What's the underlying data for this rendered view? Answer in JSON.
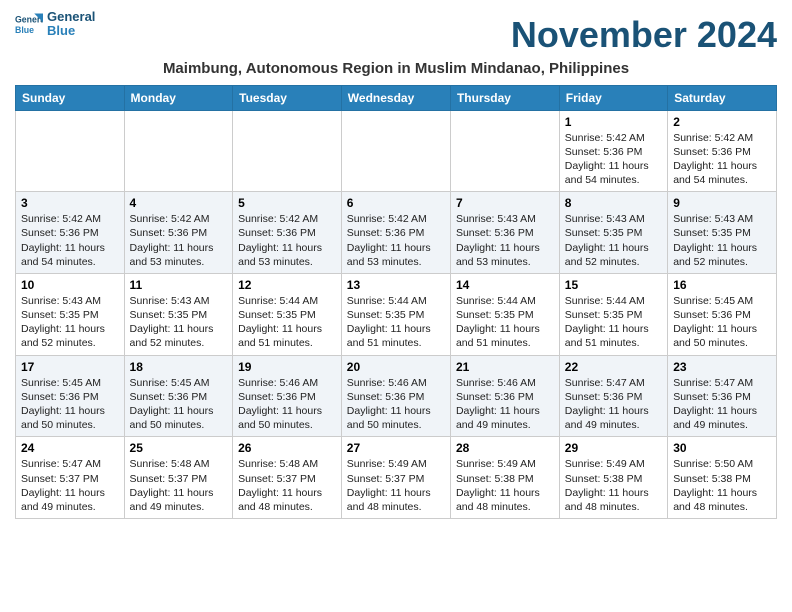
{
  "logo": {
    "line1": "General",
    "line2": "Blue"
  },
  "month_title": "November 2024",
  "location": "Maimbung, Autonomous Region in Muslim Mindanao, Philippines",
  "days_of_week": [
    "Sunday",
    "Monday",
    "Tuesday",
    "Wednesday",
    "Thursday",
    "Friday",
    "Saturday"
  ],
  "weeks": [
    [
      {
        "day": "",
        "info": ""
      },
      {
        "day": "",
        "info": ""
      },
      {
        "day": "",
        "info": ""
      },
      {
        "day": "",
        "info": ""
      },
      {
        "day": "",
        "info": ""
      },
      {
        "day": "1",
        "info": "Sunrise: 5:42 AM\nSunset: 5:36 PM\nDaylight: 11 hours and 54 minutes."
      },
      {
        "day": "2",
        "info": "Sunrise: 5:42 AM\nSunset: 5:36 PM\nDaylight: 11 hours and 54 minutes."
      }
    ],
    [
      {
        "day": "3",
        "info": "Sunrise: 5:42 AM\nSunset: 5:36 PM\nDaylight: 11 hours and 54 minutes."
      },
      {
        "day": "4",
        "info": "Sunrise: 5:42 AM\nSunset: 5:36 PM\nDaylight: 11 hours and 53 minutes."
      },
      {
        "day": "5",
        "info": "Sunrise: 5:42 AM\nSunset: 5:36 PM\nDaylight: 11 hours and 53 minutes."
      },
      {
        "day": "6",
        "info": "Sunrise: 5:42 AM\nSunset: 5:36 PM\nDaylight: 11 hours and 53 minutes."
      },
      {
        "day": "7",
        "info": "Sunrise: 5:43 AM\nSunset: 5:36 PM\nDaylight: 11 hours and 53 minutes."
      },
      {
        "day": "8",
        "info": "Sunrise: 5:43 AM\nSunset: 5:35 PM\nDaylight: 11 hours and 52 minutes."
      },
      {
        "day": "9",
        "info": "Sunrise: 5:43 AM\nSunset: 5:35 PM\nDaylight: 11 hours and 52 minutes."
      }
    ],
    [
      {
        "day": "10",
        "info": "Sunrise: 5:43 AM\nSunset: 5:35 PM\nDaylight: 11 hours and 52 minutes."
      },
      {
        "day": "11",
        "info": "Sunrise: 5:43 AM\nSunset: 5:35 PM\nDaylight: 11 hours and 52 minutes."
      },
      {
        "day": "12",
        "info": "Sunrise: 5:44 AM\nSunset: 5:35 PM\nDaylight: 11 hours and 51 minutes."
      },
      {
        "day": "13",
        "info": "Sunrise: 5:44 AM\nSunset: 5:35 PM\nDaylight: 11 hours and 51 minutes."
      },
      {
        "day": "14",
        "info": "Sunrise: 5:44 AM\nSunset: 5:35 PM\nDaylight: 11 hours and 51 minutes."
      },
      {
        "day": "15",
        "info": "Sunrise: 5:44 AM\nSunset: 5:35 PM\nDaylight: 11 hours and 51 minutes."
      },
      {
        "day": "16",
        "info": "Sunrise: 5:45 AM\nSunset: 5:36 PM\nDaylight: 11 hours and 50 minutes."
      }
    ],
    [
      {
        "day": "17",
        "info": "Sunrise: 5:45 AM\nSunset: 5:36 PM\nDaylight: 11 hours and 50 minutes."
      },
      {
        "day": "18",
        "info": "Sunrise: 5:45 AM\nSunset: 5:36 PM\nDaylight: 11 hours and 50 minutes."
      },
      {
        "day": "19",
        "info": "Sunrise: 5:46 AM\nSunset: 5:36 PM\nDaylight: 11 hours and 50 minutes."
      },
      {
        "day": "20",
        "info": "Sunrise: 5:46 AM\nSunset: 5:36 PM\nDaylight: 11 hours and 50 minutes."
      },
      {
        "day": "21",
        "info": "Sunrise: 5:46 AM\nSunset: 5:36 PM\nDaylight: 11 hours and 49 minutes."
      },
      {
        "day": "22",
        "info": "Sunrise: 5:47 AM\nSunset: 5:36 PM\nDaylight: 11 hours and 49 minutes."
      },
      {
        "day": "23",
        "info": "Sunrise: 5:47 AM\nSunset: 5:36 PM\nDaylight: 11 hours and 49 minutes."
      }
    ],
    [
      {
        "day": "24",
        "info": "Sunrise: 5:47 AM\nSunset: 5:37 PM\nDaylight: 11 hours and 49 minutes."
      },
      {
        "day": "25",
        "info": "Sunrise: 5:48 AM\nSunset: 5:37 PM\nDaylight: 11 hours and 49 minutes."
      },
      {
        "day": "26",
        "info": "Sunrise: 5:48 AM\nSunset: 5:37 PM\nDaylight: 11 hours and 48 minutes."
      },
      {
        "day": "27",
        "info": "Sunrise: 5:49 AM\nSunset: 5:37 PM\nDaylight: 11 hours and 48 minutes."
      },
      {
        "day": "28",
        "info": "Sunrise: 5:49 AM\nSunset: 5:38 PM\nDaylight: 11 hours and 48 minutes."
      },
      {
        "day": "29",
        "info": "Sunrise: 5:49 AM\nSunset: 5:38 PM\nDaylight: 11 hours and 48 minutes."
      },
      {
        "day": "30",
        "info": "Sunrise: 5:50 AM\nSunset: 5:38 PM\nDaylight: 11 hours and 48 minutes."
      }
    ]
  ]
}
